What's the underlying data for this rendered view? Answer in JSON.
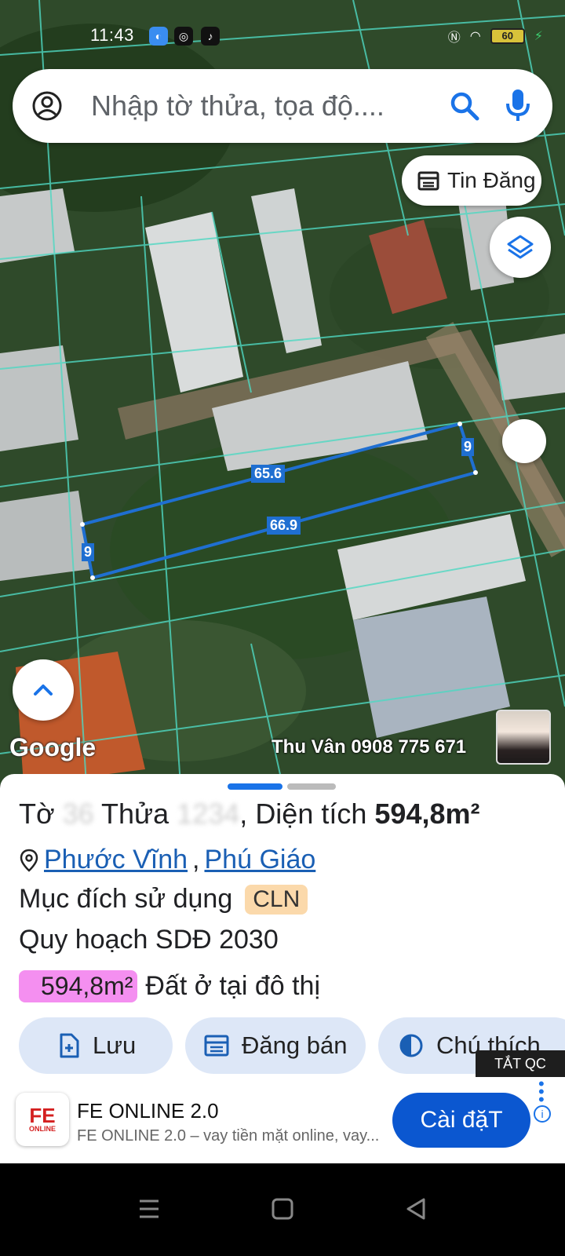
{
  "status_bar": {
    "time": "11:43",
    "battery": "60"
  },
  "search": {
    "placeholder": "Nhập tờ thửa, tọa độ...."
  },
  "map": {
    "news_chip_label": "Tin Đăng",
    "measurements": {
      "top_edge": "65.6",
      "bottom_edge": "66.9",
      "left_edge": "9",
      "right_edge": "9"
    },
    "logo_text": "Google",
    "watermark": "Thu Vân 0908 775 671"
  },
  "parcel": {
    "sheet_label": "Tờ",
    "sheet_no": "36",
    "parcel_label": "Thửa",
    "parcel_no": "1234",
    "area_label": "Diện tích",
    "area_value": "594,8m²",
    "ward": "Phước Vĩnh",
    "district": "Phú Giáo",
    "purpose_label": "Mục đích sử dụng",
    "purpose_code": "CLN",
    "plan_label": "Quy hoạch SDĐ 2030",
    "plan_area": "594,8m²",
    "plan_use": "Đất ở tại đô thị"
  },
  "actions": {
    "save": "Lưu",
    "sell": "Đăng bán",
    "legend": "Chú thích"
  },
  "ad": {
    "close_label": "TẮT QC",
    "logo_top": "FE",
    "logo_bottom": "ONLINE",
    "title": "FE ONLINE 2.0",
    "description": "FE ONLINE 2.0 – vay tiền mặt online, vay...",
    "install_label": "Cài đặT",
    "info_icon": "i"
  },
  "colors": {
    "accent": "#1a73e8",
    "parcel_outline": "#1f6fd1",
    "cln_badge": "#fbd9ab",
    "area_badge": "#f48ff0"
  }
}
